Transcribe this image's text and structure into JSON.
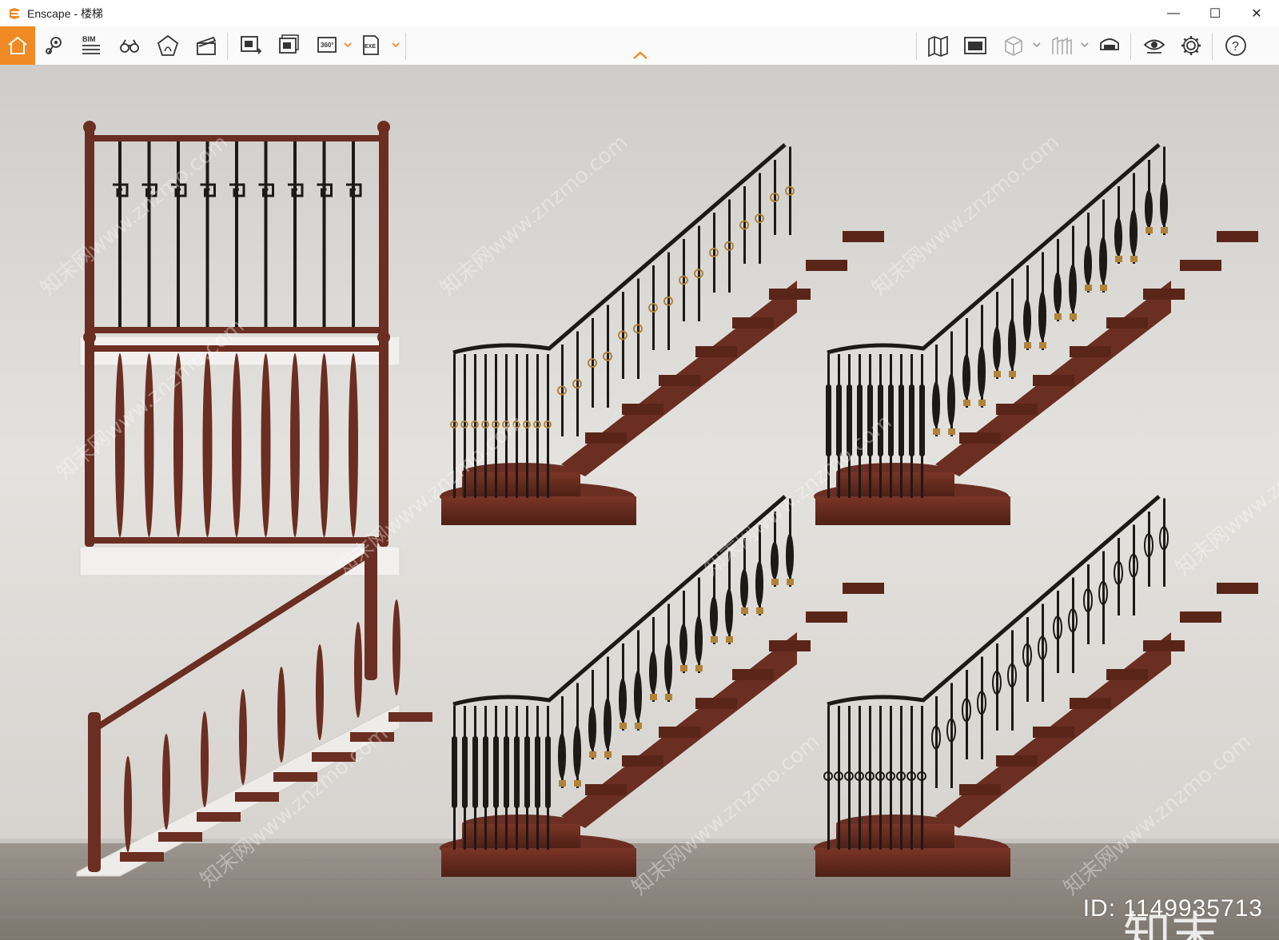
{
  "window": {
    "app_name": "Enscape",
    "separator": " - ",
    "document": "楼梯",
    "controls": {
      "minimize": "—",
      "maximize": "☐",
      "close": "✕"
    }
  },
  "toolbar": {
    "left_tools": [
      {
        "name": "home-icon",
        "label": "Home"
      },
      {
        "name": "map-pin-icon",
        "label": "Views"
      },
      {
        "name": "bim-icon",
        "label": "BIM"
      },
      {
        "name": "binoculars-icon",
        "label": "Navigate"
      },
      {
        "name": "atmosphere-icon",
        "label": "Atmosphere"
      },
      {
        "name": "clapper-icon",
        "label": "Video"
      }
    ],
    "export_tools": [
      {
        "name": "screenshot-export-icon",
        "label": "Screenshot"
      },
      {
        "name": "batch-export-icon",
        "label": "Batch"
      },
      {
        "name": "panorama-icon",
        "label": "360°"
      },
      {
        "name": "exe-export-icon",
        "label": "EXE"
      }
    ],
    "right_tools": [
      {
        "name": "map-icon",
        "label": "Map"
      },
      {
        "name": "render-window-icon",
        "label": "Render"
      },
      {
        "name": "box-icon",
        "label": "Asset"
      },
      {
        "name": "vr-icon",
        "label": "VR"
      },
      {
        "name": "headset-icon",
        "label": "Headset"
      },
      {
        "name": "eye-icon",
        "label": "Visual"
      },
      {
        "name": "gear-icon",
        "label": "Settings"
      },
      {
        "name": "help-icon",
        "label": "?"
      }
    ]
  },
  "viewport": {
    "scene": "staircase-railing-models",
    "watermark_text": "知末网www.znzmo.com",
    "brand_text": "知末",
    "id_text": "ID: 1149935713"
  },
  "colors": {
    "accent": "#f08a24",
    "wall": "#e2e0dc",
    "floor": "#8f8a84",
    "wood": "#6b2e22",
    "iron": "#1c1917",
    "gold": "#b0823a"
  }
}
